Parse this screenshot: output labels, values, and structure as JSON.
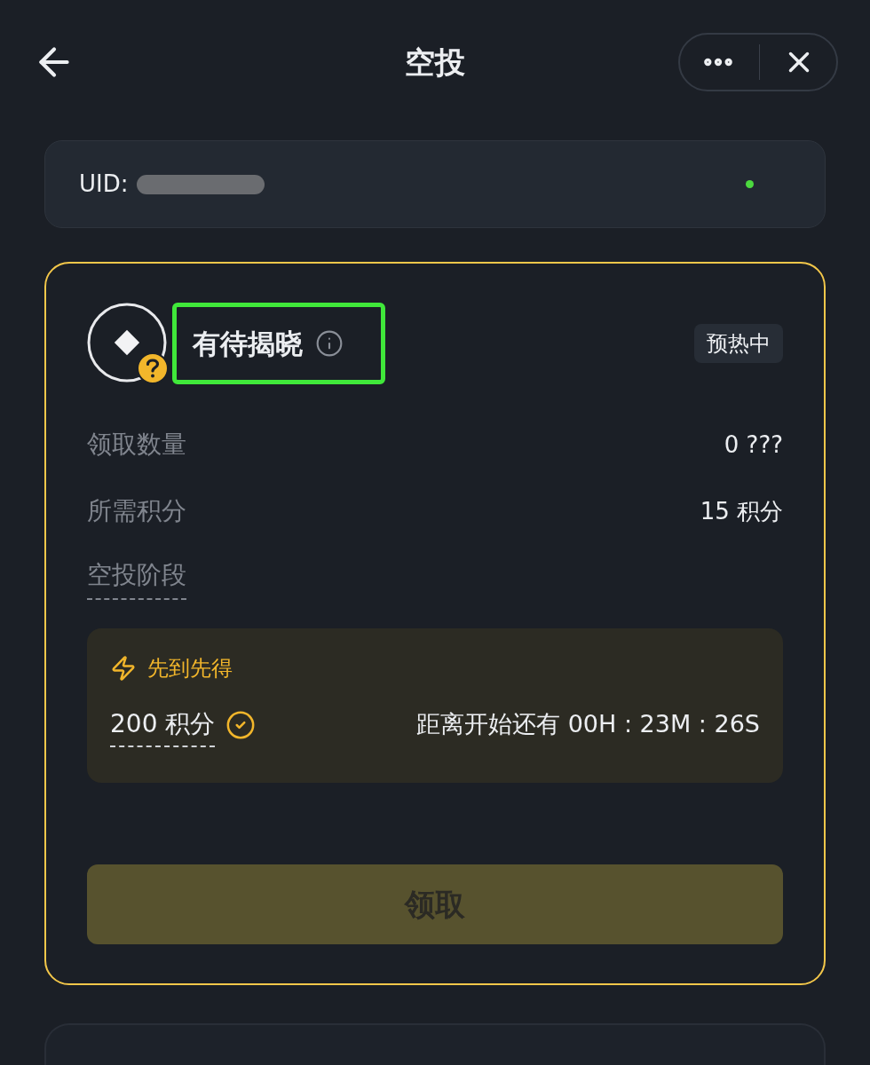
{
  "header": {
    "title": "空投"
  },
  "account": {
    "label": "UID:",
    "online": true
  },
  "airdrop": {
    "title": "有待揭晓",
    "highlighted": true,
    "status_badge": "预热中",
    "details": [
      {
        "label": "领取数量",
        "value": "0 ???"
      },
      {
        "label": "所需积分",
        "value": "15 积分"
      }
    ],
    "stage_label": "空投阶段",
    "stage": {
      "name": "先到先得",
      "points": "200 积分",
      "met": true,
      "countdown": "距离开始还有 00H : 23M : 26S"
    },
    "claim_button": {
      "label": "领取",
      "disabled": true
    }
  }
}
